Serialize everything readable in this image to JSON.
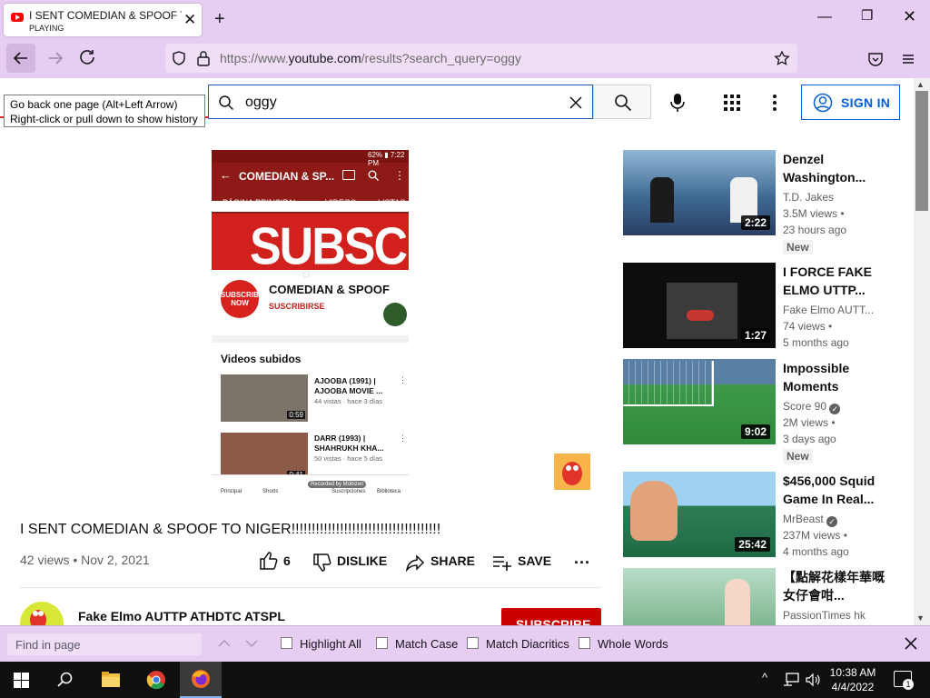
{
  "browser": {
    "tab": {
      "title": "I SENT COMEDIAN & SPOOF TO NIGER!!!!!!!!!!!!!!",
      "status": "PLAYING"
    },
    "url": {
      "prefix": "https://www.",
      "domain": "youtube.com",
      "path": "/results?search_query=oggy"
    },
    "tooltip": {
      "line1": "Go back one page (Alt+Left Arrow)",
      "line2": "Right-click or pull down to show history"
    },
    "accent_color": "#e7cdf1"
  },
  "youtube": {
    "search_value": "oggy",
    "signin_label": "SIGN IN",
    "player": {
      "phone_clock": "62% ▮ 7:22 PM",
      "channel_title": "COMEDIAN & SP...",
      "tabs": [
        "PÁGINA PRINCIPAL",
        "VIDEOS",
        "LISTAS"
      ],
      "banner": "SUBSCRIBE",
      "avatar_text": "SUBSCRIBE NOW",
      "channel_name": "COMEDIAN & SPOOF",
      "subscribe_text": "SUSCRIBIRSE",
      "videos_heading": "Videos subidos",
      "uploads": [
        {
          "title1": "AJOOBA (1991) |",
          "title2": "AJOOBA MOVIE ...",
          "meta": "44 vistas · hace 3 días",
          "duration": "0:59"
        },
        {
          "title1": "DARR (1993) |",
          "title2": "SHAHRUKH KHA...",
          "meta": "50 vistas · hace 5 días",
          "duration": "0:41"
        }
      ],
      "nav": [
        "Principal",
        "Shorts",
        "Suscripciones",
        "Biblioteca"
      ],
      "watermark": "Recorded by Mobizen"
    },
    "video": {
      "title": "I SENT COMEDIAN & SPOOF TO NIGER!!!!!!!!!!!!!!!!!!!!!!!!!!!!!!!!!!!!!",
      "meta": "42 views • Nov 2, 2021",
      "likes": "6",
      "dislike": "DISLIKE",
      "share": "SHARE",
      "save": "SAVE",
      "more": "...",
      "channel": "Fake Elmo AUTTP ATHDTC ATSPL",
      "subscribe": "SUBSCRIBE"
    },
    "related": [
      {
        "title": "Denzel Washington...",
        "channel": "T.D. Jakes",
        "views": "3.5M views •",
        "age": "23 hours ago",
        "badge": "New",
        "duration": "2:22",
        "verified": false
      },
      {
        "title": "I FORCE FAKE ELMO UTTP...",
        "channel": "Fake Elmo AUTT...",
        "views": "74 views •",
        "age": "5 months ago",
        "badge": "",
        "duration": "1:27",
        "verified": false
      },
      {
        "title": "Impossible Moments",
        "channel": "Score 90",
        "views": "2M views •",
        "age": "3 days ago",
        "badge": "New",
        "duration": "9:02",
        "verified": true
      },
      {
        "title": "$456,000 Squid Game In Real...",
        "channel": "MrBeast",
        "views": "237M views •",
        "age": "4 months ago",
        "badge": "",
        "duration": "25:42",
        "verified": true
      },
      {
        "title": "【點解花樣年華嘅女仔會咁...",
        "channel": "PassionTimes hk",
        "views": "",
        "age": "",
        "badge": "",
        "duration": "",
        "verified": false
      }
    ]
  },
  "findbar": {
    "placeholder": "Find in page",
    "options": [
      "Highlight All",
      "Match Case",
      "Match Diacritics",
      "Whole Words"
    ]
  },
  "taskbar": {
    "time": "10:38 AM",
    "date": "4/4/2022",
    "notifications": "1"
  }
}
